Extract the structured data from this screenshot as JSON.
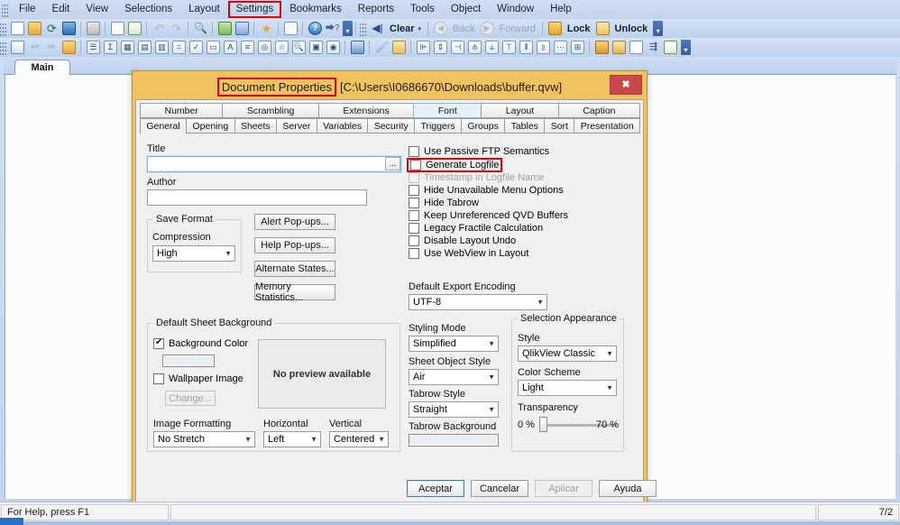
{
  "menubar": {
    "items": [
      {
        "label": "File",
        "highlighted": false
      },
      {
        "label": "Edit",
        "highlighted": false
      },
      {
        "label": "View",
        "highlighted": false
      },
      {
        "label": "Selections",
        "highlighted": false
      },
      {
        "label": "Layout",
        "highlighted": false
      },
      {
        "label": "Settings",
        "highlighted": true
      },
      {
        "label": "Bookmarks",
        "highlighted": false
      },
      {
        "label": "Reports",
        "highlighted": false
      },
      {
        "label": "Tools",
        "highlighted": false
      },
      {
        "label": "Object",
        "highlighted": false
      },
      {
        "label": "Window",
        "highlighted": false
      },
      {
        "label": "Help",
        "highlighted": false
      }
    ]
  },
  "toolbar_selections": {
    "clear_label": "Clear",
    "back_label": "Back",
    "forward_label": "Forward",
    "lock_label": "Lock",
    "unlock_label": "Unlock"
  },
  "sheet": {
    "tab_label": "Main"
  },
  "dialog": {
    "title_main": "Document Properties",
    "title_path": "[C:\\Users\\I0686670\\Downloads\\buffer.qvw]",
    "close_label": "✖",
    "tabs_top": [
      "Number",
      "Scrambling",
      "Extensions",
      "Font",
      "Layout",
      "Caption"
    ],
    "tabs_top_selected": "Font",
    "tabs_bottom": [
      "General",
      "Opening",
      "Sheets",
      "Server",
      "Variables",
      "Security",
      "Triggers",
      "Groups",
      "Tables",
      "Sort",
      "Presentation"
    ],
    "tabs_bottom_selected": "General",
    "general": {
      "title_label": "Title",
      "title_value": "",
      "title_browse": "...",
      "author_label": "Author",
      "author_value": "",
      "save_format_group": "Save Format",
      "compression_label": "Compression",
      "compression_value": "High",
      "buttons": [
        "Alert Pop-ups...",
        "Help Pop-ups...",
        "Alternate States...",
        "Memory Statistics..."
      ],
      "checkboxes": [
        {
          "label": "Use Passive FTP Semantics",
          "checked": false,
          "disabled": false,
          "highlighted": false
        },
        {
          "label": "Generate Logfile",
          "checked": false,
          "disabled": false,
          "highlighted": true
        },
        {
          "label": "Timestamp in Logfile Name",
          "checked": false,
          "disabled": true,
          "highlighted": false
        },
        {
          "label": "Hide Unavailable Menu Options",
          "checked": false,
          "disabled": false,
          "highlighted": false
        },
        {
          "label": "Hide Tabrow",
          "checked": false,
          "disabled": false,
          "highlighted": false
        },
        {
          "label": "Keep Unreferenced QVD Buffers",
          "checked": false,
          "disabled": false,
          "highlighted": false
        },
        {
          "label": "Legacy Fractile Calculation",
          "checked": false,
          "disabled": false,
          "highlighted": false
        },
        {
          "label": "Disable Layout Undo",
          "checked": false,
          "disabled": false,
          "highlighted": false
        },
        {
          "label": "Use WebView in Layout",
          "checked": false,
          "disabled": false,
          "highlighted": false
        }
      ],
      "export_encoding_label": "Default Export Encoding",
      "export_encoding_value": "UTF-8",
      "sheet_background_group": "Default Sheet Background",
      "background_color_label": "Background Color",
      "background_color_checked": true,
      "wallpaper_image_label": "Wallpaper Image",
      "wallpaper_image_checked": false,
      "change_button": "Change...",
      "preview_text": "No preview available",
      "image_formatting_label": "Image Formatting",
      "image_formatting_value": "No Stretch",
      "horizontal_label": "Horizontal",
      "horizontal_value": "Left",
      "vertical_label": "Vertical",
      "vertical_value": "Centered",
      "styling_mode_label": "Styling Mode",
      "styling_mode_value": "Simplified",
      "sheet_object_style_label": "Sheet Object Style",
      "sheet_object_style_value": "Air",
      "tabrow_style_label": "Tabrow Style",
      "tabrow_style_value": "Straight",
      "tabrow_background_label": "Tabrow Background",
      "selection_appearance_group": "Selection Appearance",
      "style_label": "Style",
      "style_value": "QlikView Classic",
      "color_scheme_label": "Color Scheme",
      "color_scheme_value": "Light",
      "transparency_label": "Transparency",
      "transparency_min": "0 %",
      "transparency_max": "70 %"
    },
    "footer_buttons": [
      {
        "label": "Aceptar",
        "state": "default"
      },
      {
        "label": "Cancelar",
        "state": "normal"
      },
      {
        "label": "Aplicar",
        "state": "disabled"
      },
      {
        "label": "Ayuda",
        "state": "normal"
      }
    ]
  },
  "statusbar": {
    "help_text": "For Help, press F1",
    "right_text": "7/2"
  },
  "colors": {
    "dialog_border": "#f0c35e",
    "highlight_red": "#e00000",
    "close_button": "#c9484b",
    "selected_tab": "#e4f1fb"
  }
}
